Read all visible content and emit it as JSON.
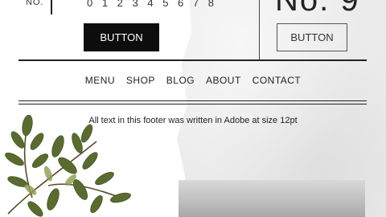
{
  "header": {
    "no_label": "NO.",
    "digits": "0 1 2 3 4 5 6 7 8",
    "big_number": "No. 9"
  },
  "buttons": {
    "dark_label": "BUTTON",
    "light_label": "BUTTON"
  },
  "nav": {
    "items": [
      "MENU",
      "SHOP",
      "BLOG",
      "ABOUT",
      "CONTACT"
    ]
  },
  "footer": {
    "text": "All text in this footer was written in Adobe at size 12pt"
  },
  "colors": {
    "ink": "#222222",
    "button_dark": "#0d0d0d",
    "paper": "#ebebeb",
    "leaf": "#5a6b2f"
  }
}
